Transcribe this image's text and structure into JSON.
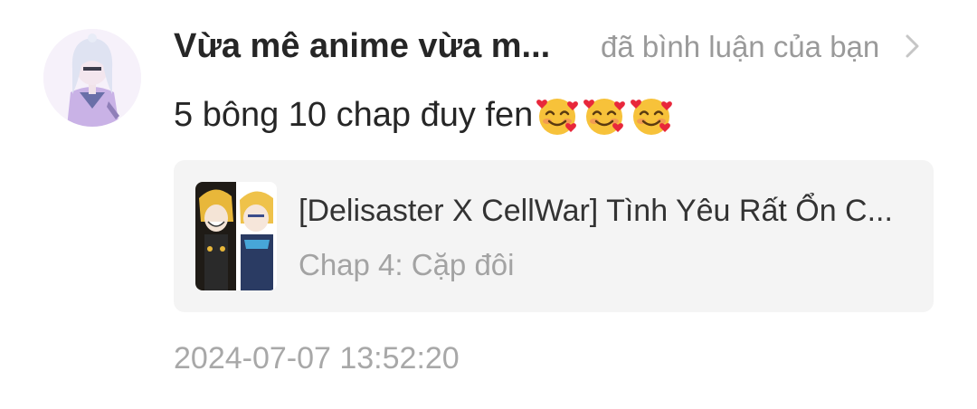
{
  "notification": {
    "username": "Vừa mê anime vừa m...",
    "action_text": "đã bình luận của bạn",
    "comment_text": "5 bông 10 chap đuy fen",
    "comment_emojis": [
      "smiling-face-with-hearts",
      "smiling-face-with-hearts",
      "smiling-face-with-hearts"
    ],
    "timestamp": "2024-07-07 13:52:20"
  },
  "story_card": {
    "title": "[Delisaster X CellWar] Tình Yêu Rất Ổn C...",
    "chapter": "Chap 4: Cặp đôi"
  },
  "icons": {
    "chevron": "chevron-right-icon",
    "emoji": "smiling-face-with-hearts-icon"
  },
  "colors": {
    "card_background": "#f4f4f4",
    "muted_text": "#9a9a9a",
    "primary_text": "#262626"
  }
}
